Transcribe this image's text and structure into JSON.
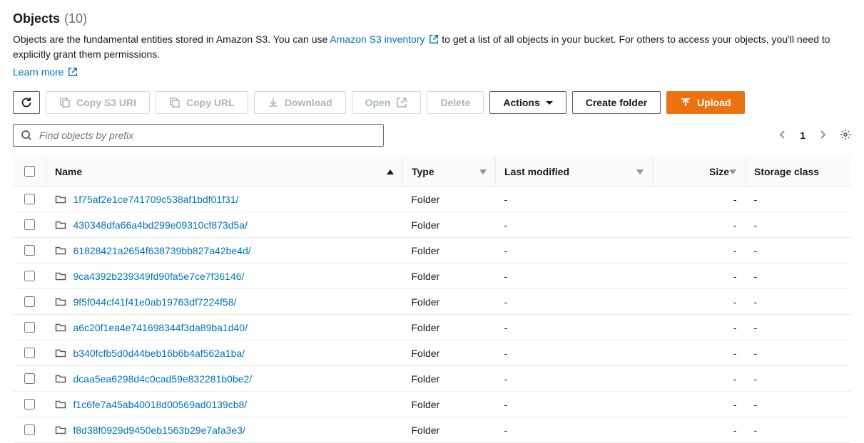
{
  "header": {
    "title": "Objects",
    "count": "(10)"
  },
  "desc": {
    "pre": "Objects are the fundamental entities stored in Amazon S3. You can use ",
    "inventory_link": "Amazon S3 inventory",
    "post": " to get a list of all objects in your bucket. For others to access your objects, you'll need to explicitly grant them permissions.",
    "learn": "Learn more"
  },
  "toolbar": {
    "copy_uri": "Copy S3 URI",
    "copy_url": "Copy URL",
    "download": "Download",
    "open": "Open",
    "delete": "Delete",
    "actions": "Actions",
    "create_folder": "Create folder",
    "upload": "Upload"
  },
  "search": {
    "placeholder": "Find objects by prefix"
  },
  "pager": {
    "page": "1"
  },
  "columns": {
    "name": "Name",
    "type": "Type",
    "last_modified": "Last modified",
    "size": "Size",
    "storage_class": "Storage class"
  },
  "rows": [
    {
      "name": "1f75af2e1ce741709c538af1bdf01f31/",
      "type": "Folder",
      "last_modified": "-",
      "size": "-",
      "storage_class": "-"
    },
    {
      "name": "430348dfa66a4bd299e09310cf873d5a/",
      "type": "Folder",
      "last_modified": "-",
      "size": "-",
      "storage_class": "-"
    },
    {
      "name": "61828421a2654f638739bb827a42be4d/",
      "type": "Folder",
      "last_modified": "-",
      "size": "-",
      "storage_class": "-"
    },
    {
      "name": "9ca4392b239349fd90fa5e7ce7f36146/",
      "type": "Folder",
      "last_modified": "-",
      "size": "-",
      "storage_class": "-"
    },
    {
      "name": "9f5f044cf41f41e0ab19763df7224f58/",
      "type": "Folder",
      "last_modified": "-",
      "size": "-",
      "storage_class": "-"
    },
    {
      "name": "a6c20f1ea4e741698344f3da89ba1d40/",
      "type": "Folder",
      "last_modified": "-",
      "size": "-",
      "storage_class": "-"
    },
    {
      "name": "b340fcfb5d0d44beb16b6b4af562a1ba/",
      "type": "Folder",
      "last_modified": "-",
      "size": "-",
      "storage_class": "-"
    },
    {
      "name": "dcaa5ea6298d4c0cad59e832281b0be2/",
      "type": "Folder",
      "last_modified": "-",
      "size": "-",
      "storage_class": "-"
    },
    {
      "name": "f1c6fe7a45ab40018d00569ad0139cb8/",
      "type": "Folder",
      "last_modified": "-",
      "size": "-",
      "storage_class": "-"
    },
    {
      "name": "f8d38f0929d9450eb1563b29e7afa3e3/",
      "type": "Folder",
      "last_modified": "-",
      "size": "-",
      "storage_class": "-"
    }
  ]
}
